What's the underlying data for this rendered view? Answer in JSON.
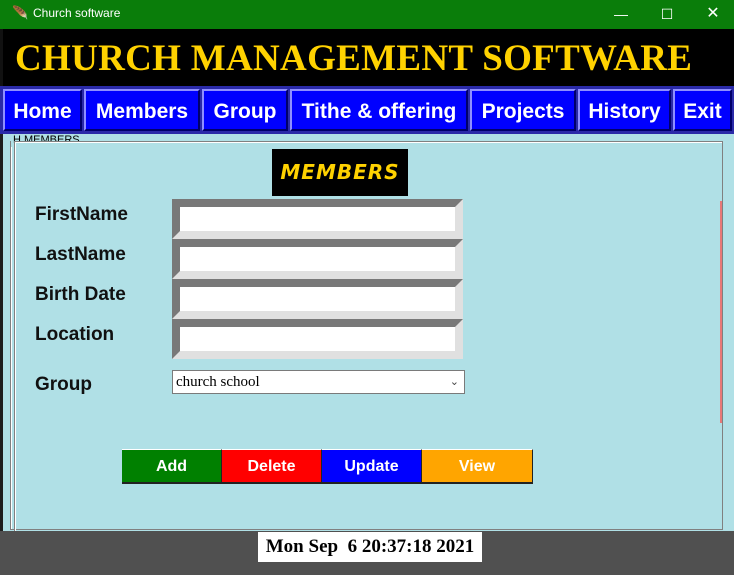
{
  "window": {
    "title": "Church software",
    "app_icon": "feather-icon",
    "controls": {
      "minimize": "—",
      "maximize": "☐",
      "close": "✕"
    }
  },
  "banner": {
    "title": "CHURCH MANAGEMENT SOFTWARE",
    "color": "#ffd200",
    "background": "#000000"
  },
  "menu": {
    "items": [
      "Home",
      "Members",
      "Group",
      "Tithe & offering",
      "Projects",
      "History",
      "Exit"
    ],
    "background": "#0000ff"
  },
  "section": {
    "legend": "H MEMBERS",
    "badge": "MEMBERS"
  },
  "form": {
    "fields": [
      {
        "label": "FirstName",
        "value": ""
      },
      {
        "label": "LastName",
        "value": ""
      },
      {
        "label": "Birth Date",
        "value": ""
      },
      {
        "label": "Location",
        "value": ""
      }
    ],
    "group": {
      "label": "Group",
      "selected": "church school"
    }
  },
  "actions": [
    {
      "label": "Add",
      "color": "#008000"
    },
    {
      "label": "Delete",
      "color": "#ff0000"
    },
    {
      "label": "Update",
      "color": "#0000ff"
    },
    {
      "label": "View",
      "color": "#ffa500"
    }
  ],
  "status": {
    "datetime": "Mon Sep  6 20:37:18 2021"
  },
  "colors": {
    "titlebar": "#0a7d0a",
    "panel": "#b0e0e6"
  }
}
